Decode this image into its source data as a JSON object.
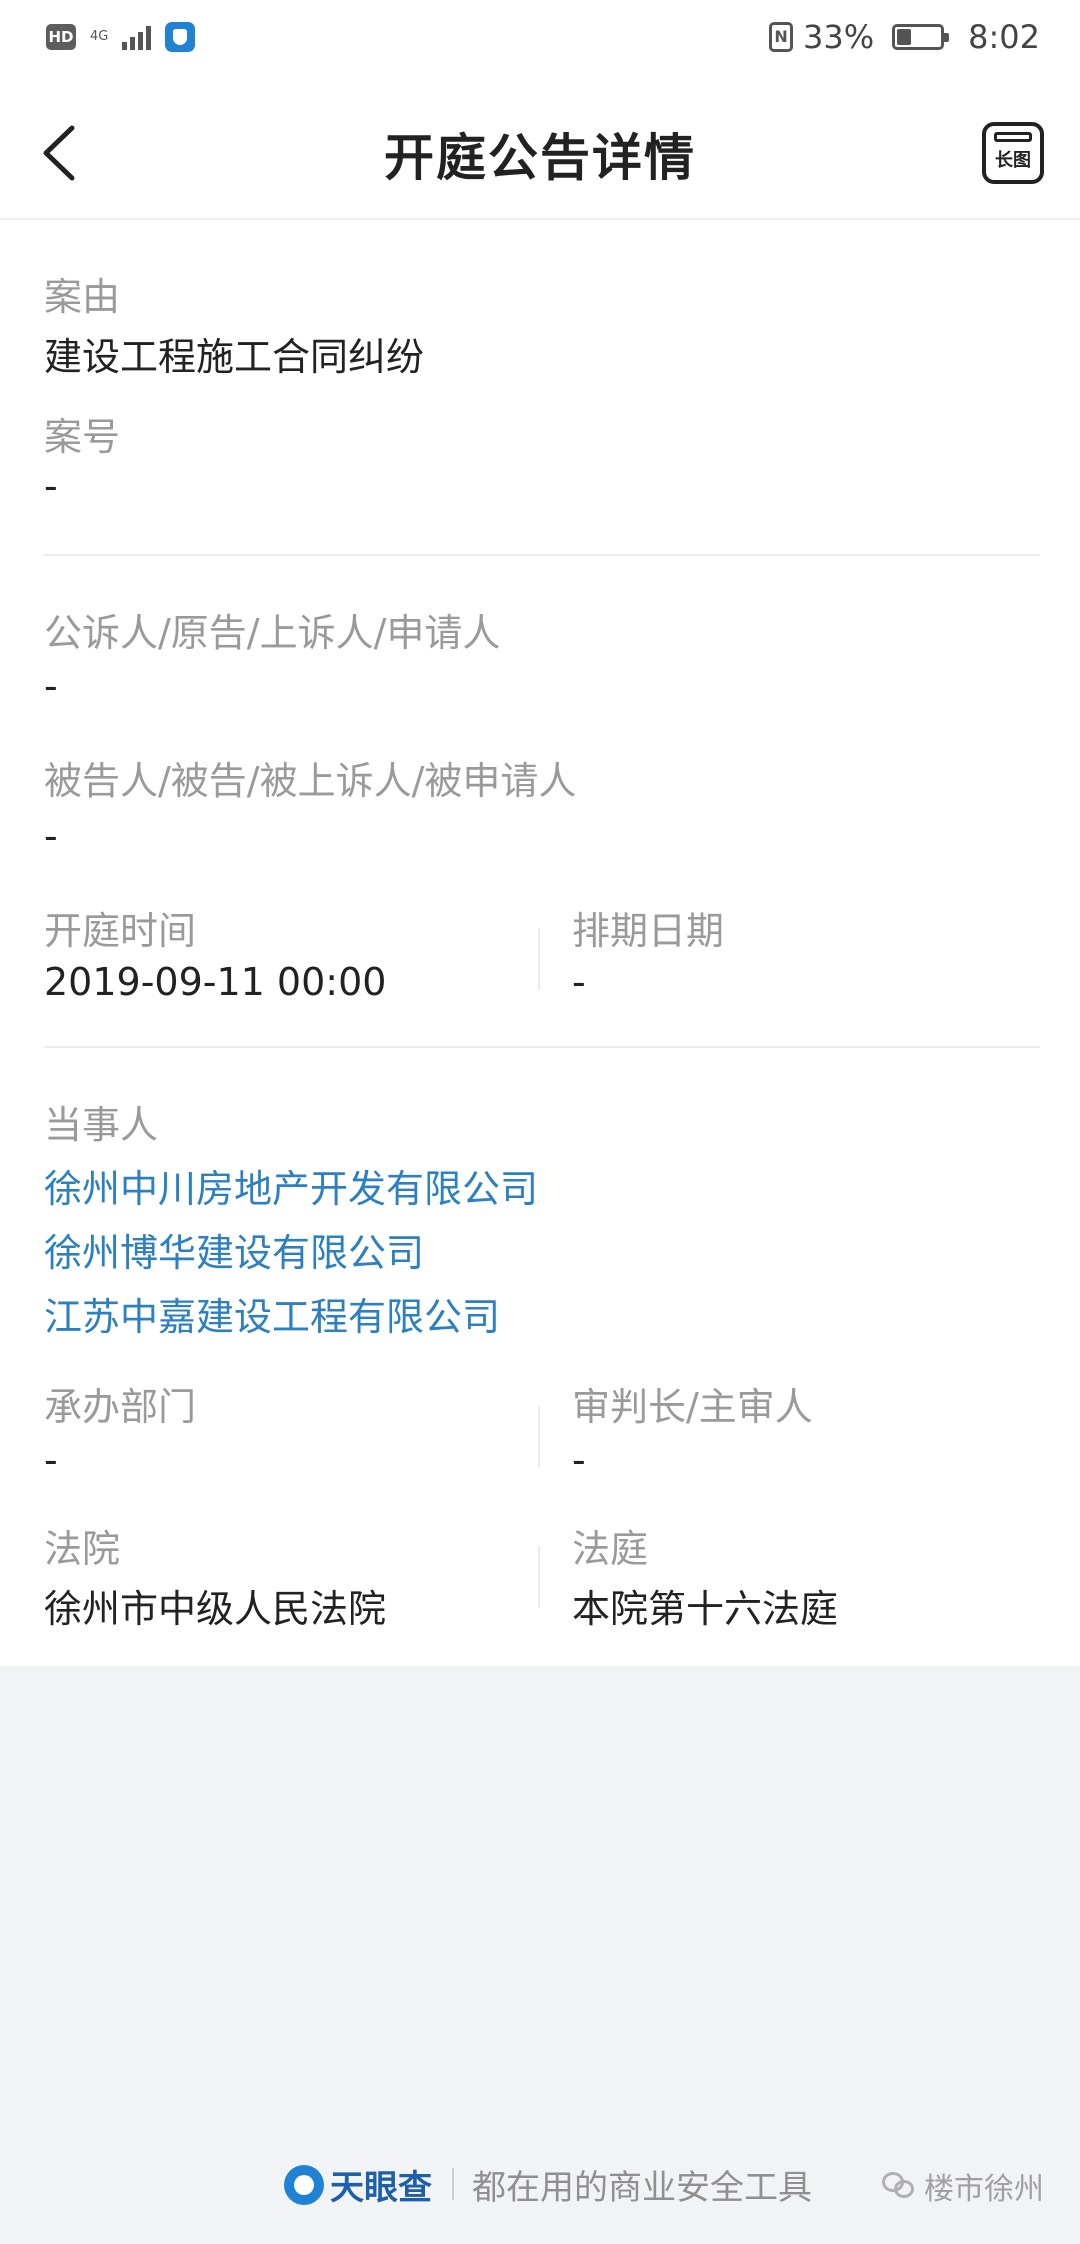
{
  "status_bar": {
    "hd": "HD",
    "network": "4G",
    "battery_percent": "33%",
    "battery_level": 0.33,
    "time": "8:02"
  },
  "header": {
    "title": "开庭公告详情",
    "longimg_label": "长图"
  },
  "fields": {
    "cause_label": "案由",
    "cause_value": "建设工程施工合同纠纷",
    "case_no_label": "案号",
    "case_no_value": "-",
    "plaintiff_label": "公诉人/原告/上诉人/申请人",
    "plaintiff_value": "-",
    "defendant_label": "被告人/被告/被上诉人/被申请人",
    "defendant_value": "-",
    "hearing_time_label": "开庭时间",
    "hearing_time_value": "2019-09-11 00:00",
    "schedule_date_label": "排期日期",
    "schedule_date_value": "-",
    "parties_label": "当事人",
    "parties": [
      "徐州中川房地产开发有限公司",
      "徐州博华建设有限公司",
      "江苏中嘉建设工程有限公司"
    ],
    "department_label": "承办部门",
    "department_value": "-",
    "judge_label": "审判长/主审人",
    "judge_value": "-",
    "court_label": "法院",
    "court_value": "徐州市中级人民法院",
    "courtroom_label": "法庭",
    "courtroom_value": "本院第十六法庭"
  },
  "footer": {
    "brand": "天眼查",
    "slogan": "都在用的商业安全工具",
    "watermark": "楼市徐州"
  },
  "colors": {
    "link": "#2c7fc0",
    "label": "#9a9a9a",
    "brand": "#1f82d4"
  }
}
